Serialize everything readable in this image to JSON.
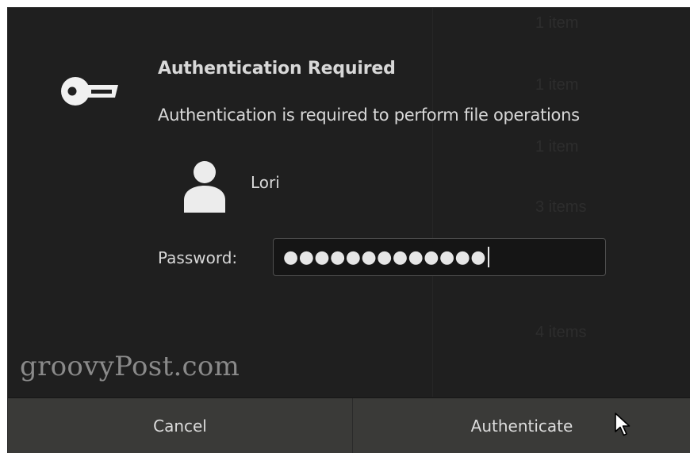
{
  "dialog": {
    "title": "Authentication Required",
    "message": "Authentication is required to perform file operations",
    "icon": "key-icon",
    "user": {
      "name": "Lori",
      "avatar_icon": "user-avatar-icon"
    },
    "password": {
      "label": "Password:",
      "masked_value": "●●●●●●●●●●●●●"
    },
    "buttons": {
      "cancel_label": "Cancel",
      "authenticate_label": "Authenticate"
    }
  },
  "background_ghost": {
    "items": [
      "1 item",
      "1 item",
      "1 item",
      "3 items",
      "4 items"
    ]
  },
  "watermark": "groovyPost.com",
  "colors": {
    "panel_background": "#1f1f1f",
    "button_background": "#3a3a38",
    "text": "#d8d8d8"
  }
}
